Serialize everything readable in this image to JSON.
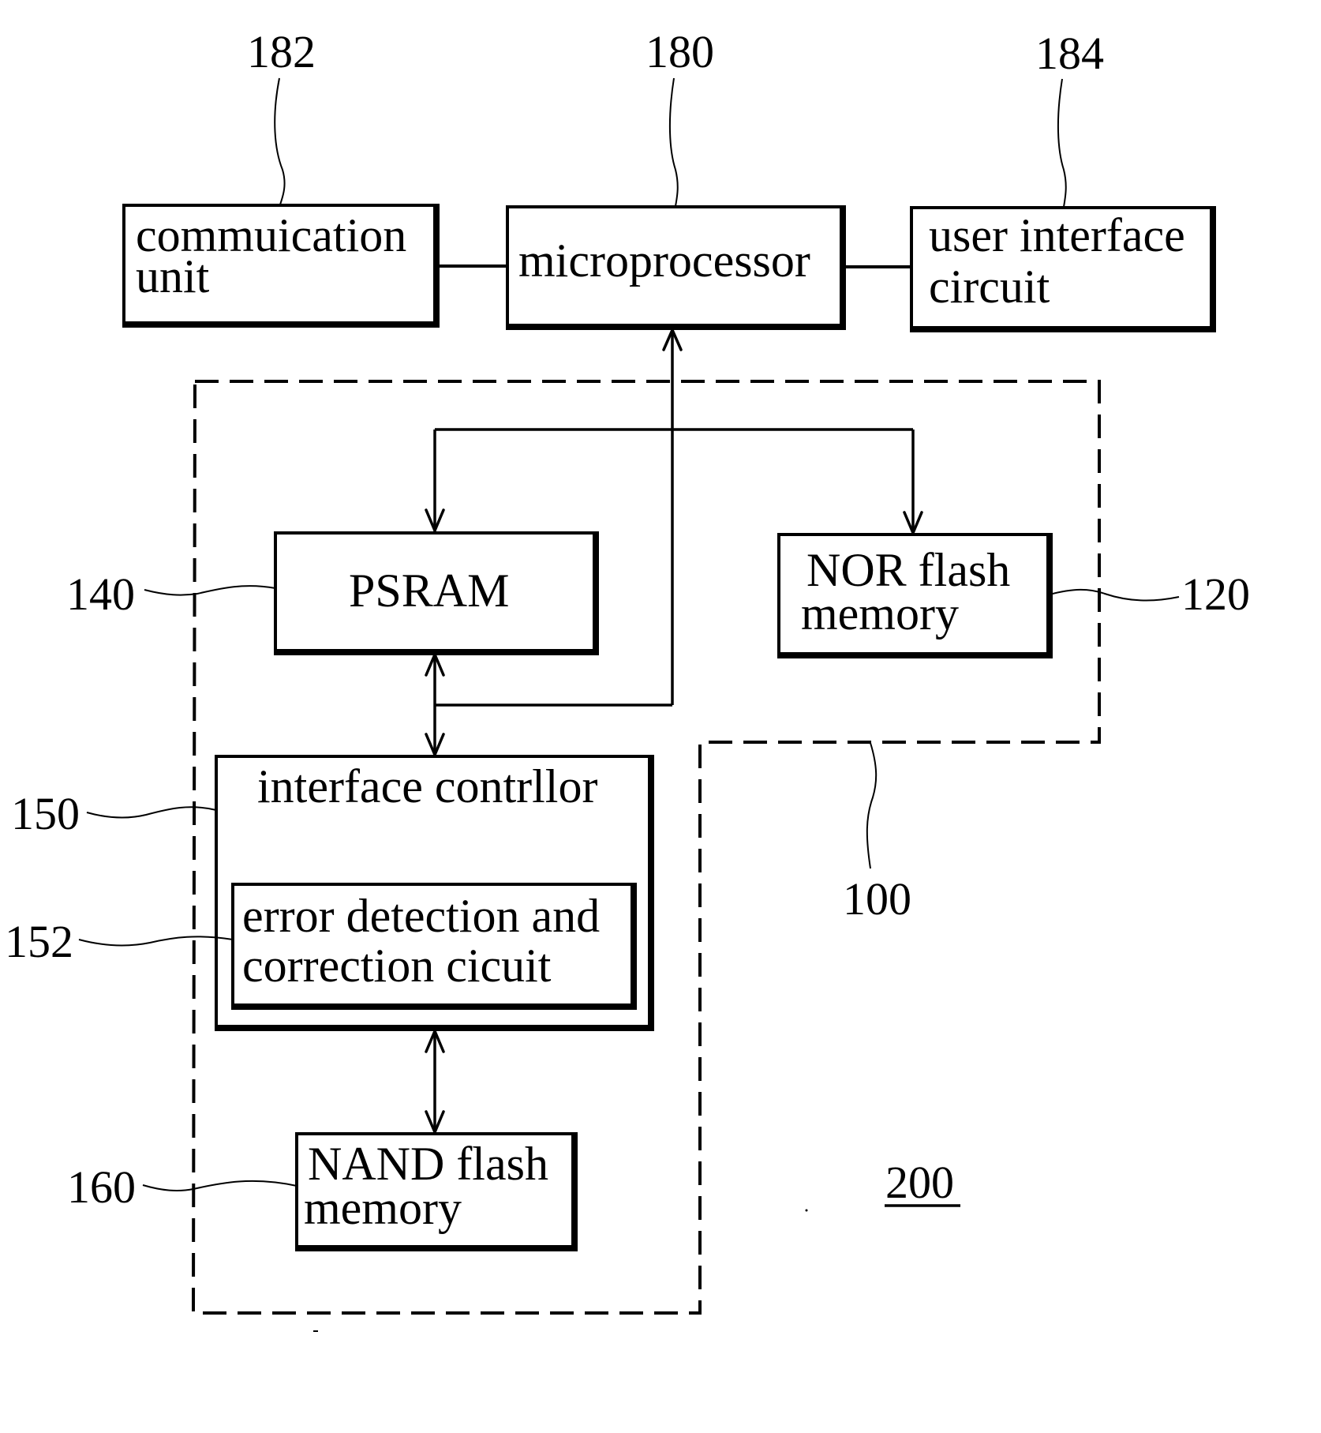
{
  "figure": {
    "system_label": "200",
    "module_label": "100",
    "colors": {
      "ink": "#000000",
      "background": "#ffffff"
    }
  },
  "blocks": {
    "communication_unit": {
      "ref": "182",
      "lines": [
        "commuication",
        "unit"
      ]
    },
    "microprocessor": {
      "ref": "180",
      "lines": [
        "microprocessor"
      ]
    },
    "user_interface_circuit": {
      "ref": "184",
      "lines": [
        "user interface",
        "circuit"
      ]
    },
    "psram": {
      "ref": "140",
      "lines": [
        "PSRAM"
      ]
    },
    "nor_flash": {
      "ref": "120",
      "lines": [
        "NOR flash",
        "memory"
      ]
    },
    "interface_controller": {
      "ref": "150",
      "lines": [
        "interface contrllor"
      ]
    },
    "edc_circuit": {
      "ref": "152",
      "lines": [
        "error detection and",
        "correction cicuit"
      ]
    },
    "nand_flash": {
      "ref": "160",
      "lines": [
        "NAND flash",
        "memory"
      ]
    }
  },
  "connections": [
    {
      "from": "communication_unit",
      "to": "microprocessor",
      "type": "line"
    },
    {
      "from": "microprocessor",
      "to": "user_interface_circuit",
      "type": "line"
    },
    {
      "from": "bus",
      "to": "microprocessor",
      "type": "arrow"
    },
    {
      "from": "bus",
      "to": "psram",
      "type": "arrow"
    },
    {
      "from": "bus",
      "to": "nor_flash",
      "type": "arrow"
    },
    {
      "from": "psram",
      "to": "interface_controller",
      "type": "bidirectional"
    },
    {
      "from": "interface_controller",
      "to": "nand_flash",
      "type": "bidirectional"
    }
  ]
}
